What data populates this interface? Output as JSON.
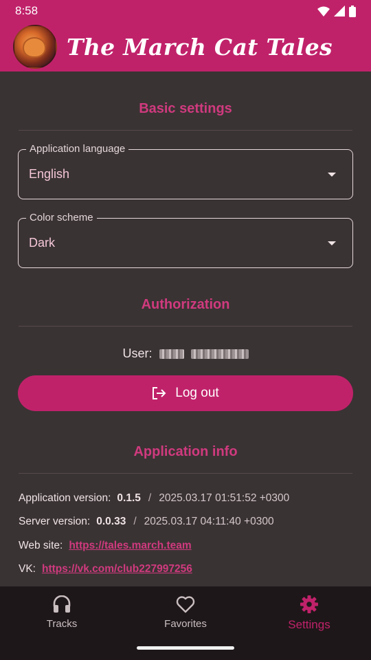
{
  "status_bar": {
    "time": "8:58"
  },
  "app_bar": {
    "title": "The March Cat Tales"
  },
  "basic_settings": {
    "title": "Basic settings",
    "language": {
      "label": "Application language",
      "value": "English"
    },
    "color_scheme": {
      "label": "Color scheme",
      "value": "Dark"
    }
  },
  "authorization": {
    "title": "Authorization",
    "user_label": "User:",
    "logout_label": "Log out"
  },
  "app_info": {
    "title": "Application info",
    "app_version_label": "Application version:",
    "app_version": "0.1.5",
    "app_version_date": "2025.03.17 01:51:52 +0300",
    "server_version_label": "Server version:",
    "server_version": "0.0.33",
    "server_version_date": "2025.03.17 04:11:40 +0300",
    "website_label": "Web site:",
    "website_url": "https://tales.march.team",
    "vk_label": "VK:",
    "vk_url": "https://vk.com/club227997256"
  },
  "bottom_nav": {
    "tracks": "Tracks",
    "favorites": "Favorites",
    "settings": "Settings"
  },
  "colors": {
    "accent": "#c0226a",
    "background": "#3a3334",
    "nav_background": "#1e1719"
  }
}
